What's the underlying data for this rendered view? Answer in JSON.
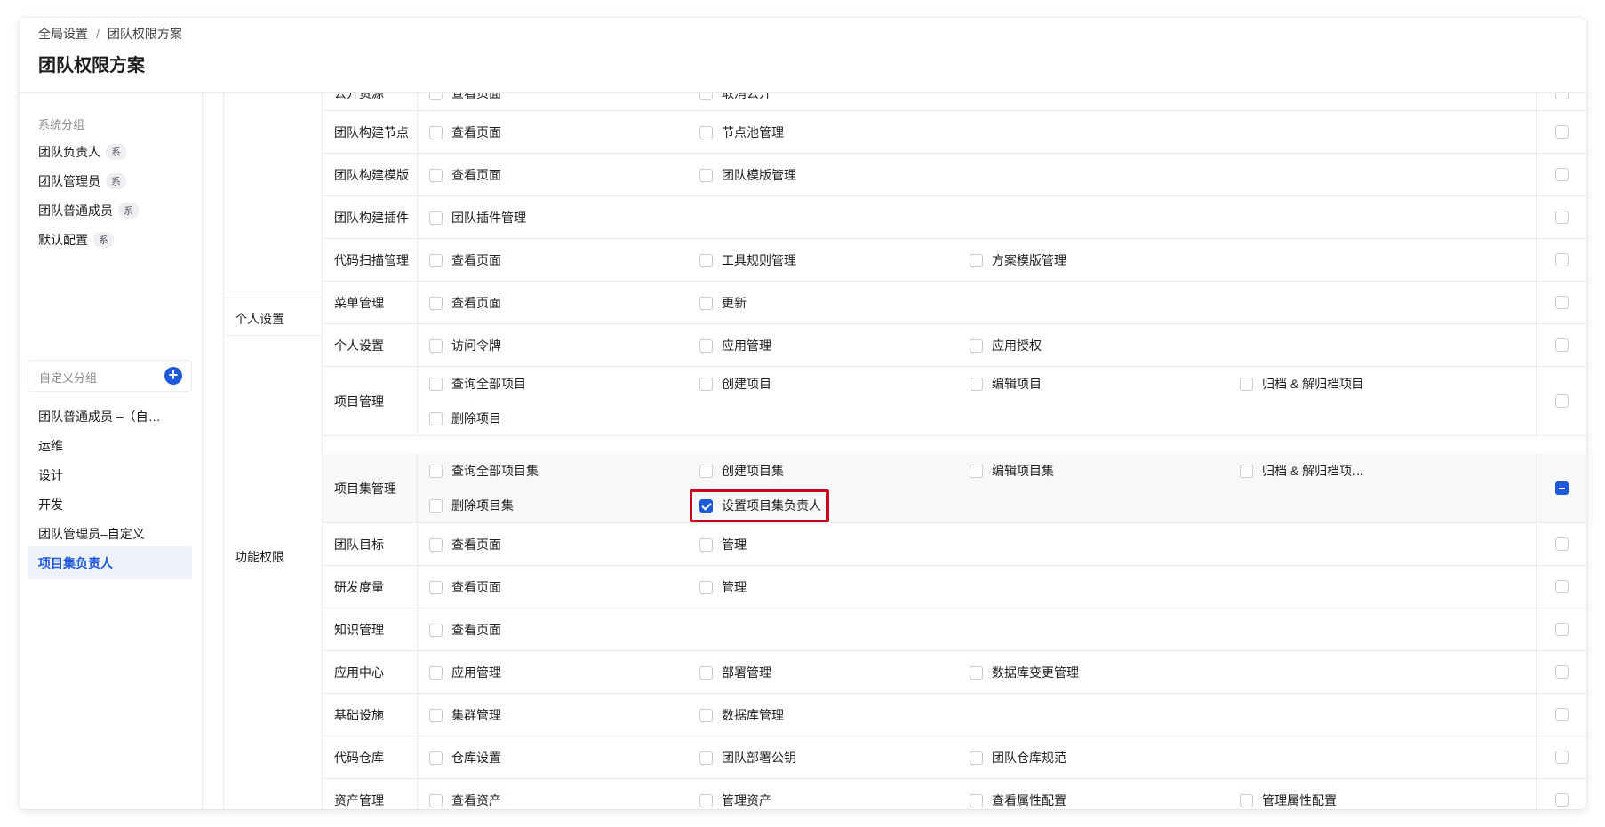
{
  "breadcrumb": {
    "root": "全局设置",
    "separator": "/",
    "current": "团队权限方案"
  },
  "page_title": "团队权限方案",
  "sidebar": {
    "system_group_label": "系统分组",
    "system_badge": "系",
    "system_items": [
      "团队负责人",
      "团队管理员",
      "团队普通成员",
      "默认配置"
    ],
    "custom_group_label": "自定义分组",
    "add_icon": "+",
    "custom_items": [
      "团队普通成员 –（自定义）",
      "运维",
      "设计",
      "开发",
      "团队管理员–自定义",
      "项目集负责人"
    ],
    "active_item": "项目集负责人"
  },
  "categories": {
    "personal": "个人设置",
    "function": "功能权限"
  },
  "rows": [
    {
      "name": "公开资源",
      "options": [
        [
          "查看页面",
          false
        ],
        [
          "取消公开",
          false
        ]
      ],
      "row_state": "unchecked"
    },
    {
      "name": "团队构建节点",
      "options": [
        [
          "查看页面",
          false
        ],
        [
          "节点池管理",
          false
        ]
      ],
      "row_state": "unchecked"
    },
    {
      "name": "团队构建模版",
      "options": [
        [
          "查看页面",
          false
        ],
        [
          "团队模版管理",
          false
        ]
      ],
      "row_state": "unchecked"
    },
    {
      "name": "团队构建插件",
      "options": [
        [
          "团队插件管理",
          false
        ]
      ],
      "row_state": "unchecked"
    },
    {
      "name": "代码扫描管理",
      "options": [
        [
          "查看页面",
          false
        ],
        [
          "工具规则管理",
          false
        ],
        [
          "方案模版管理",
          false
        ]
      ],
      "row_state": "unchecked"
    },
    {
      "name": "菜单管理",
      "options": [
        [
          "查看页面",
          false
        ],
        [
          "更新",
          false
        ]
      ],
      "row_state": "unchecked"
    },
    {
      "name": "个人设置",
      "options": [
        [
          "访问令牌",
          false
        ],
        [
          "应用管理",
          false
        ],
        [
          "应用授权",
          false
        ]
      ],
      "row_state": "unchecked"
    },
    {
      "name": "项目管理",
      "options": [
        [
          "查询全部项目",
          false
        ],
        [
          "创建项目",
          false
        ],
        [
          "编辑项目",
          false
        ],
        [
          "归档 & 解归档项目",
          false
        ],
        [
          "删除项目",
          false
        ]
      ],
      "row_state": "unchecked"
    },
    {
      "name": "项目集管理",
      "options": [
        [
          "查询全部项目集",
          false
        ],
        [
          "创建项目集",
          false
        ],
        [
          "编辑项目集",
          false
        ],
        [
          "归档 & 解归档项…",
          false
        ],
        [
          "删除项目集",
          false
        ],
        [
          "设置项目集负责人",
          true
        ]
      ],
      "row_state": "indeterminate"
    },
    {
      "name": "团队目标",
      "options": [
        [
          "查看页面",
          false
        ],
        [
          "管理",
          false
        ]
      ],
      "row_state": "unchecked"
    },
    {
      "name": "研发度量",
      "options": [
        [
          "查看页面",
          false
        ],
        [
          "管理",
          false
        ]
      ],
      "row_state": "unchecked"
    },
    {
      "name": "知识管理",
      "options": [
        [
          "查看页面",
          false
        ]
      ],
      "row_state": "unchecked"
    },
    {
      "name": "应用中心",
      "options": [
        [
          "应用管理",
          false
        ],
        [
          "部署管理",
          false
        ],
        [
          "数据库变更管理",
          false
        ]
      ],
      "row_state": "unchecked"
    },
    {
      "name": "基础设施",
      "options": [
        [
          "集群管理",
          false
        ],
        [
          "数据库管理",
          false
        ]
      ],
      "row_state": "unchecked"
    },
    {
      "name": "代码仓库",
      "options": [
        [
          "仓库设置",
          false
        ],
        [
          "团队部署公钥",
          false
        ],
        [
          "团队仓库规范",
          false
        ]
      ],
      "row_state": "unchecked"
    },
    {
      "name": "资产管理",
      "options": [
        [
          "查看资产",
          false
        ],
        [
          "管理资产",
          false
        ],
        [
          "查看属性配置",
          false
        ],
        [
          "管理属性配置",
          false
        ]
      ],
      "row_state": "unchecked"
    }
  ],
  "highlight": {
    "row": "项目集管理",
    "option": "设置项目集负责人",
    "color": "#d0021b"
  },
  "colors": {
    "accent": "#1e5ad8",
    "border": "#ececee",
    "highlight_box": "#d0021b"
  }
}
